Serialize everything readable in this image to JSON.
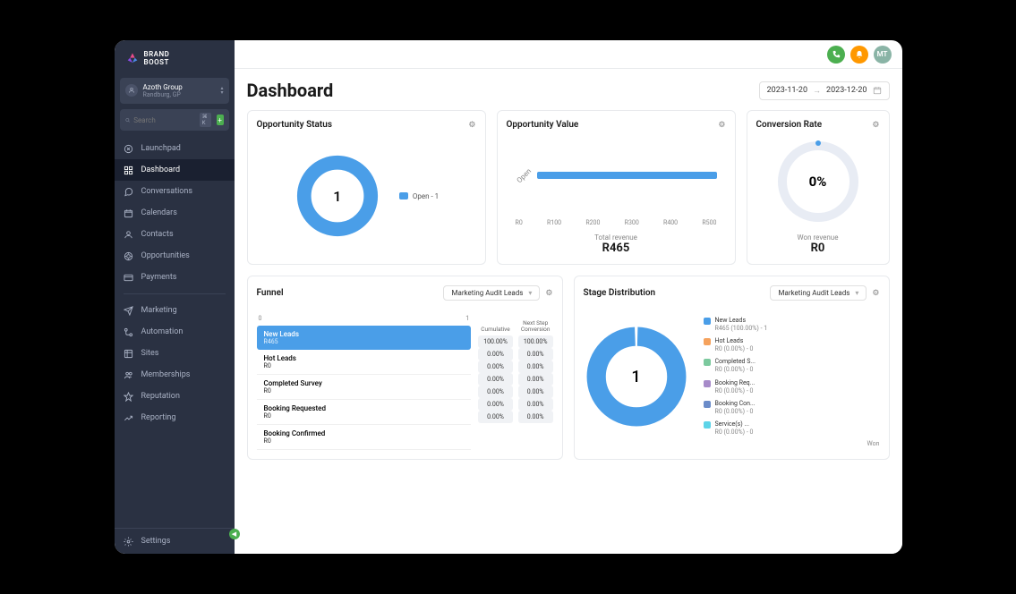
{
  "brand": {
    "line1": "BRAND",
    "line2": "BOOST"
  },
  "org": {
    "name": "Azoth Group",
    "location": "Randburg, GP"
  },
  "search": {
    "placeholder": "Search",
    "shortcut": "⌘ K"
  },
  "nav": {
    "items": [
      {
        "label": "Launchpad",
        "icon": "compass"
      },
      {
        "label": "Dashboard",
        "icon": "grid",
        "active": true
      },
      {
        "label": "Conversations",
        "icon": "chat"
      },
      {
        "label": "Calendars",
        "icon": "calendar"
      },
      {
        "label": "Contacts",
        "icon": "user"
      },
      {
        "label": "Opportunities",
        "icon": "target"
      },
      {
        "label": "Payments",
        "icon": "card"
      }
    ],
    "items2": [
      {
        "label": "Marketing",
        "icon": "send"
      },
      {
        "label": "Automation",
        "icon": "flow"
      },
      {
        "label": "Sites",
        "icon": "site"
      },
      {
        "label": "Memberships",
        "icon": "member"
      },
      {
        "label": "Reputation",
        "icon": "star"
      },
      {
        "label": "Reporting",
        "icon": "trend"
      }
    ],
    "settings": "Settings"
  },
  "topbar": {
    "avatar": "MT"
  },
  "page": {
    "title": "Dashboard"
  },
  "dateRange": {
    "from": "2023-11-20",
    "to": "2023-12-20"
  },
  "cards": {
    "opportunityStatus": {
      "title": "Opportunity Status",
      "value": "1",
      "legend": "Open - 1"
    },
    "opportunityValue": {
      "title": "Opportunity Value",
      "barLabel": "Open",
      "axis": [
        "R0",
        "R100",
        "R200",
        "R300",
        "R400",
        "R500"
      ],
      "footerLabel": "Total revenue",
      "footerValue": "R465"
    },
    "conversionRate": {
      "title": "Conversion Rate",
      "value": "0%",
      "footerLabel": "Won revenue",
      "footerValue": "R0"
    }
  },
  "funnel": {
    "title": "Funnel",
    "dropdown": "Marketing Audit Leads",
    "scaleMin": "0",
    "scaleMax": "1",
    "colHead1": "Cumulative",
    "colHead2": "Next Step\nConversion",
    "stages": [
      {
        "name": "New Leads",
        "value": "R465",
        "active": true,
        "cum": "100.00%",
        "next": "100.00%"
      },
      {
        "name": "",
        "value": "",
        "spacer": true,
        "cum": "0.00%",
        "next": "0.00%"
      },
      {
        "name": "Hot Leads",
        "value": "R0",
        "cum": "0.00%",
        "next": "0.00%"
      },
      {
        "name": "",
        "value": "",
        "spacer": true,
        "cum": "0.00%",
        "next": "0.00%"
      },
      {
        "name": "Completed Survey",
        "value": "R0",
        "cum": "0.00%",
        "next": "0.00%"
      },
      {
        "name": "Booking Requested",
        "value": "R0",
        "cum": "0.00%",
        "next": "0.00%"
      },
      {
        "name": "Booking Confirmed",
        "value": "R0",
        "cum": "0.00%",
        "next": "0.00%"
      }
    ]
  },
  "stage": {
    "title": "Stage Distribution",
    "dropdown": "Marketing Audit Leads",
    "value": "1",
    "legend": [
      {
        "name": "New Leads",
        "sub": "R465 (100.00%) - 1",
        "color": "#4a9ee8"
      },
      {
        "name": "Hot Leads",
        "sub": "R0 (0.00%) - 0",
        "color": "#f5a25d"
      },
      {
        "name": "Completed S...",
        "sub": "R0 (0.00%) - 0",
        "color": "#7cc99e"
      },
      {
        "name": "Booking Req...",
        "sub": "R0 (0.00%) - 0",
        "color": "#a78bc9"
      },
      {
        "name": "Booking Con...",
        "sub": "R0 (0.00%) - 0",
        "color": "#6b8cc9"
      },
      {
        "name": "Service(s) ...",
        "sub": "R0 (0.00%) - 0",
        "color": "#5dd4e8"
      }
    ],
    "wonLabel": "Won"
  },
  "chart_data": [
    {
      "type": "pie",
      "title": "Opportunity Status",
      "categories": [
        "Open"
      ],
      "values": [
        1
      ]
    },
    {
      "type": "bar",
      "title": "Opportunity Value",
      "categories": [
        "Open"
      ],
      "values": [
        465
      ],
      "xlabel": "",
      "ylabel": "",
      "xlim": [
        0,
        500
      ]
    },
    {
      "type": "pie",
      "title": "Stage Distribution",
      "categories": [
        "New Leads",
        "Hot Leads",
        "Completed Survey",
        "Booking Requested",
        "Booking Confirmed",
        "Service(s)"
      ],
      "values": [
        1,
        0,
        0,
        0,
        0,
        0
      ]
    }
  ]
}
